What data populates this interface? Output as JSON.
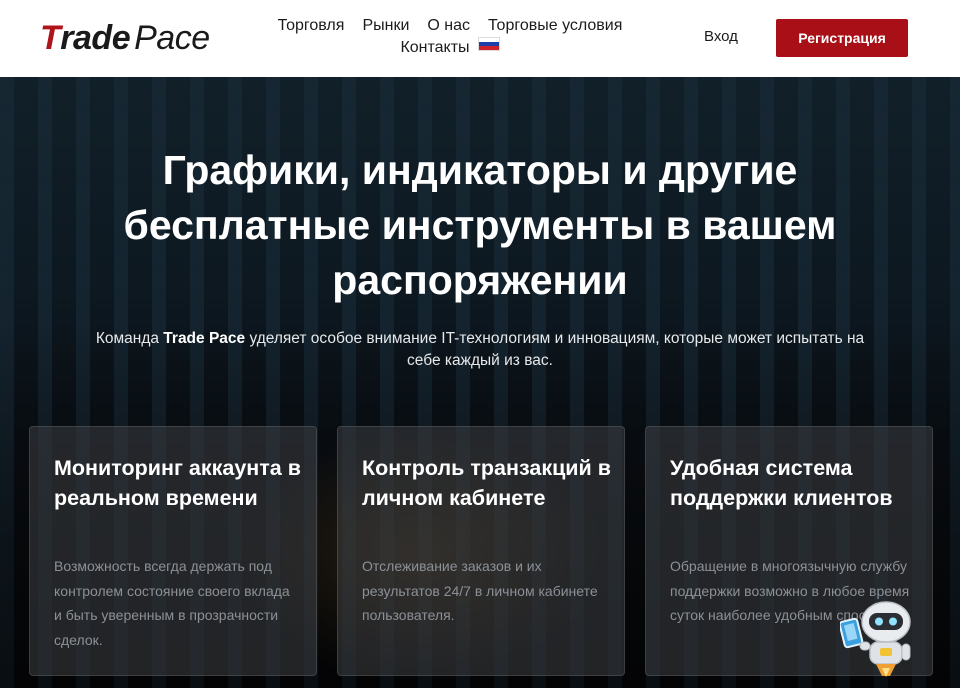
{
  "header": {
    "logo": {
      "t": "T",
      "rade": "rade",
      "pace": "Pace"
    },
    "nav": [
      {
        "label": "Торговля"
      },
      {
        "label": "Рынки"
      },
      {
        "label": "О нас"
      },
      {
        "label": "Торговые условия"
      },
      {
        "label": "Контакты"
      }
    ],
    "language_flag": "russia-flag-icon",
    "login_label": "Вход",
    "register_label": "Регистрация",
    "colors": {
      "brand_red": "#a80f16"
    }
  },
  "hero": {
    "title": "Графики, индикаторы и другие бесплатные инструменты в вашем распоряжении",
    "subtitle_before": "Команда ",
    "subtitle_brand": "Trade Pace",
    "subtitle_after": " уделяет особое внимание IT-технологиям и инновациям, которые может испытать на себе каждый из вас."
  },
  "features": [
    {
      "title": "Мониторинг аккаунта в реальном времени",
      "text": "Возможность всегда держать под контролем состояние своего вклада и быть уверенным в прозрачности сделок."
    },
    {
      "title": "Контроль транзакций в личном кабинете",
      "text": "Отслеживание заказов и их результатов 24/7 в личном кабинете пользователя."
    },
    {
      "title": "Удобная система поддержки клиентов",
      "text": "Обращение в многоязычную службу поддержки возможно в любое время суток наиболее удобным способом."
    }
  ],
  "support_widget": "robot-assistant-icon"
}
